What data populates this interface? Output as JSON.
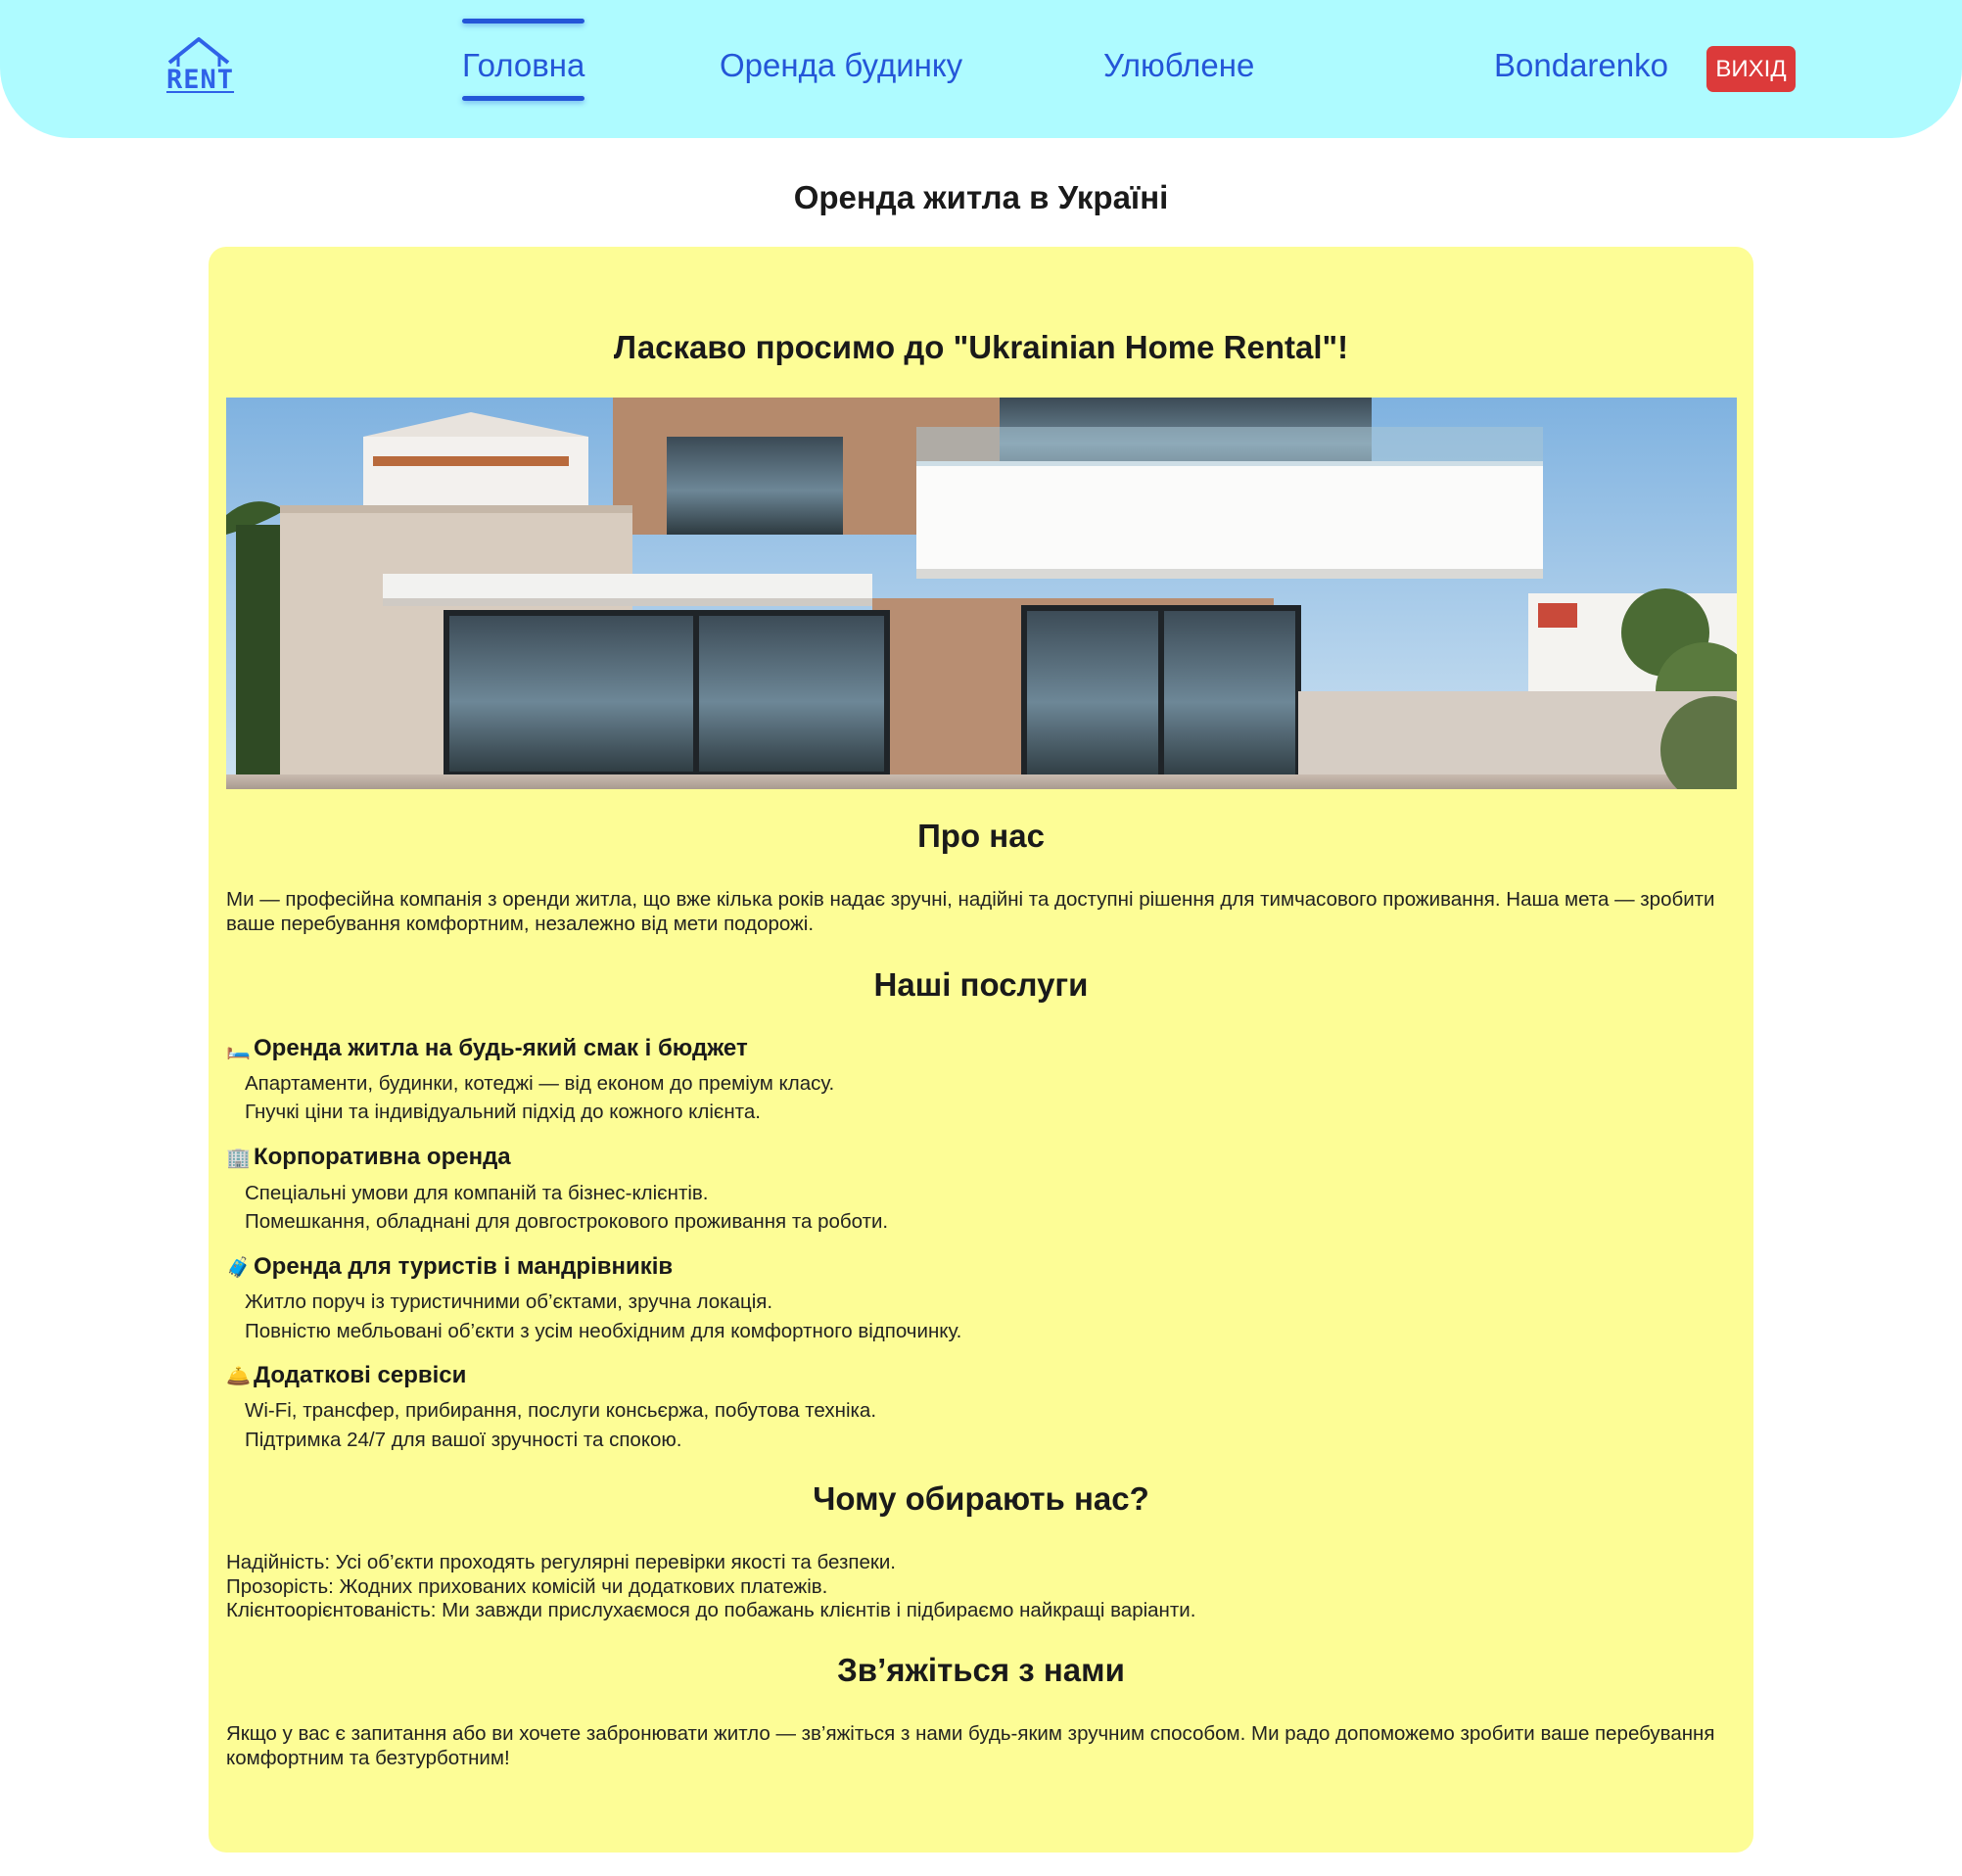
{
  "header": {
    "logo_text": "RENT",
    "nav": [
      {
        "label": "Головна",
        "active": true
      },
      {
        "label": "Оренда будинку",
        "active": false
      },
      {
        "label": "Улюблене",
        "active": false
      }
    ],
    "username": "Bondarenko",
    "logout_label": "ВИХІД"
  },
  "page_title": "Оренда житла в Україні",
  "main": {
    "welcome": "Ласкаво просимо до \"Ukrainian Home Rental\"!",
    "about": {
      "heading": "Про нас",
      "text": "Ми — професійна компанія з оренди житла, що вже кілька років надає зручні, надійні та доступні рішення для тимчасового проживання. Наша мета — зробити ваше перебування комфортним, незалежно від мети подорожі."
    },
    "services": {
      "heading": "Наші послуги",
      "items": [
        {
          "icon": "🛏️",
          "title": "Оренда житла на будь-який смак і бюджет",
          "lines": [
            "Апартаменти, будинки, котеджі — від економ до преміум класу.",
            "Гнучкі ціни та індивідуальний підхід до кожного клієнта."
          ]
        },
        {
          "icon": "🏢",
          "title": "Корпоративна оренда",
          "lines": [
            "Спеціальні умови для компаній та бізнес-клієнтів.",
            "Помешкання, обладнані для довгострокового проживання та роботи."
          ]
        },
        {
          "icon": "🧳",
          "title": "Оренда для туристів і мандрівників",
          "lines": [
            "Житло поруч із туристичними об’єктами, зручна локація.",
            "Повністю мебльовані об’єкти з усім необхідним для комфортного відпочинку."
          ]
        },
        {
          "icon": "🛎️",
          "title": "Додаткові сервіси",
          "lines": [
            "Wi-Fi, трансфер, прибирання, послуги консьєржа, побутова техніка.",
            "Підтримка 24/7 для вашої зручності та спокою."
          ]
        }
      ]
    },
    "why": {
      "heading": "Чому обирають нас?",
      "lines": [
        "Надійність: Усі об’єкти проходять регулярні перевірки якості та безпеки.",
        "Прозорість: Жодних прихованих комісій чи додаткових платежів.",
        "Клієнтоорієнтованість: Ми завжди прислухаємося до побажань клієнтів і підбираємо найкращі варіанти."
      ]
    },
    "contact": {
      "heading": "Зв’яжіться з нами",
      "text": "Якщо у вас є запитання або ви хочете забронювати житло — зв’яжіться з нами будь-яким зручним способом. Ми радо допоможемо зробити ваше перебування комфортним та безтурботним!"
    }
  },
  "colors": {
    "header_bg": "#aefbff",
    "nav_text": "#2456d8",
    "logout_bg": "#dc3a3a",
    "card_bg": "#fdfd96"
  }
}
